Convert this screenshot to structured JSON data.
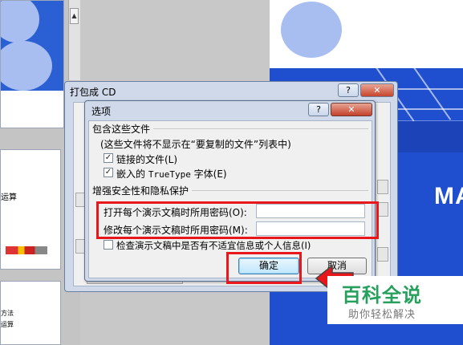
{
  "background": {
    "left_panel": {
      "thumb2_text": "运算",
      "thumb3_line1": "方法",
      "thumb3_line2": "运算"
    },
    "slide": {
      "title_fragment": "MA"
    }
  },
  "outer_dialog": {
    "title": "打包成 CD",
    "help": "?",
    "close": "✕"
  },
  "options_dialog": {
    "title": "选项",
    "help": "?",
    "close": "✕",
    "include_group": {
      "label": "包含这些文件",
      "note": "(这些文件将不显示在“要复制的文件”列表中)",
      "linked_files": {
        "label": "链接的文件(L)",
        "checked": true
      },
      "embedded_fonts": {
        "label_prefix": "嵌入的",
        "label_mono": "TrueType",
        "label_suffix": "字体(E)",
        "checked": true
      }
    },
    "security_group": {
      "label": "增强安全性和隐私保护",
      "open_password_label": "打开每个演示文稿时所用密码(O):",
      "open_password_value": "",
      "modify_password_label": "修改每个演示文稿时所用密码(M):",
      "modify_password_value": "",
      "inspect": {
        "label": "检查演示文稿中是否有不适宜信息或个人信息(I)",
        "checked": false
      }
    },
    "buttons": {
      "ok": "确定",
      "cancel": "取消"
    }
  },
  "annotations": {
    "highlight_color": "#e8171c"
  },
  "watermark": {
    "title": "百科全说",
    "subtitle": "助你轻松解决"
  },
  "colors": {
    "slide_blue": "#1f4fcf",
    "dialog_frame": "#cfd9ea",
    "watermark_green": "#26a05c"
  }
}
